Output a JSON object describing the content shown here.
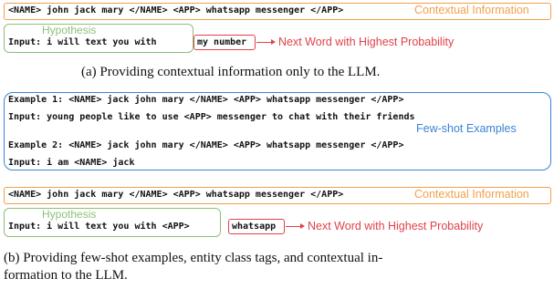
{
  "panel_a": {
    "context_line": "<NAME> john jack mary </NAME> <APP> whatsapp messenger </APP>",
    "context_tag": "Contextual Information",
    "hypothesis_tag": "Hypothesis",
    "input_line": "Input: i will text you with",
    "predicted": "my number",
    "prediction_tag": "Next Word with Highest Probability",
    "caption": "(a)  Providing contextual information only to the LLM."
  },
  "panel_b": {
    "examples": [
      "Example 1: <NAME> jack john mary </NAME> <APP> whatsapp messenger </APP>",
      "Input: young people like to use <APP> messenger to chat with their friends",
      "Example 2: <NAME> jack john mary </NAME> <APP> whatsapp messenger </APP>",
      "Input: i am <NAME> jack"
    ],
    "fewshot_tag": "Few-shot Examples",
    "context_line": "<NAME> john jack mary </NAME> <APP> whatsapp messenger </APP>",
    "context_tag": "Contextual Information",
    "hypothesis_tag": "Hypothesis",
    "input_line": "Input: i will text you with <APP>",
    "predicted": "whatsapp",
    "prediction_tag": "Next Word with Highest Probability",
    "caption_line1": "(b)  Providing few-shot examples, entity class tags, and contextual in-",
    "caption_line2": "formation to the LLM."
  },
  "colors": {
    "context": "#f2a04c",
    "hypothesis": "#8dc07a",
    "prediction": "#e0424a",
    "fewshot": "#3a84d6"
  }
}
